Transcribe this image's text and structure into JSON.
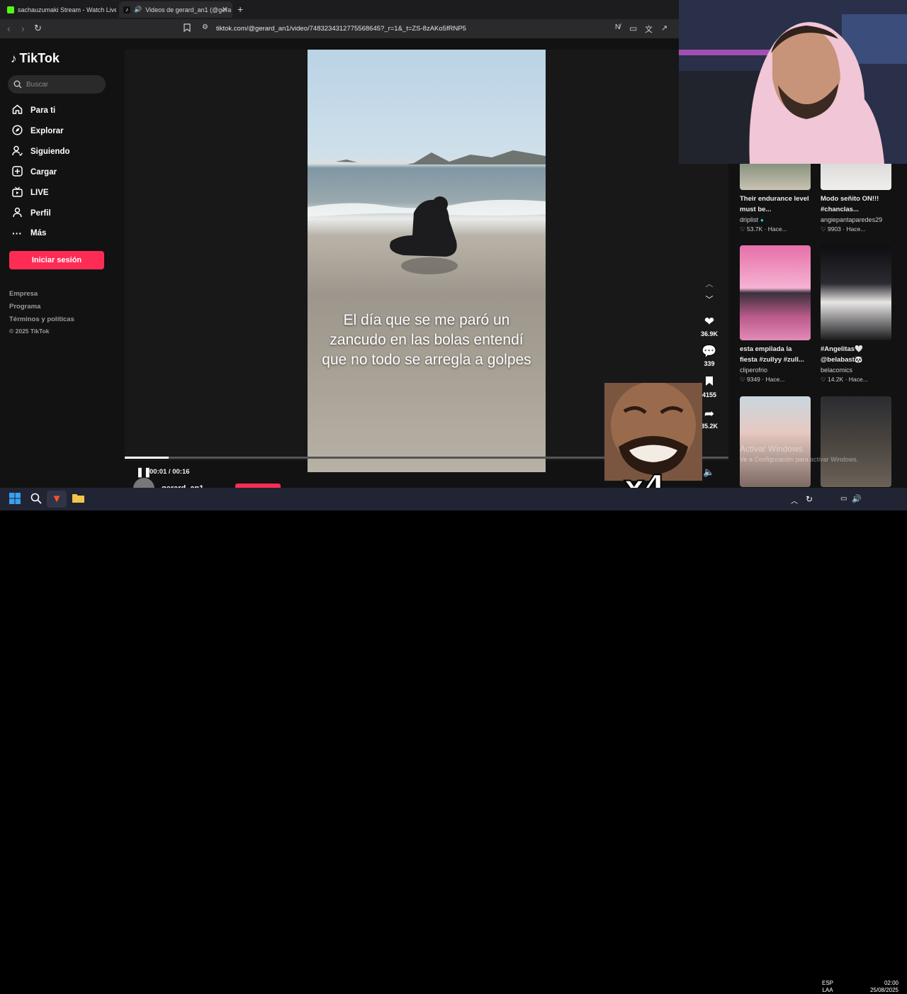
{
  "browser": {
    "tabs": [
      {
        "title": "sachauzumaki Stream - Watch Live o",
        "favicon_color": "#53fc18"
      },
      {
        "title": "Videos de gerard_an1 (@gera",
        "favicon_color": "#ffffff"
      }
    ],
    "url": "tiktok.com/@gerard_an1/video/7483234312775568645?_r=1&_t=ZS-8zAKo5fRNP5"
  },
  "sidebar": {
    "logo": "TikTok",
    "search_placeholder": "Buscar",
    "nav": [
      {
        "label": "Para ti",
        "icon": "home-icon"
      },
      {
        "label": "Explorar",
        "icon": "compass-icon"
      },
      {
        "label": "Siguiendo",
        "icon": "following-icon"
      },
      {
        "label": "Cargar",
        "icon": "upload-icon"
      },
      {
        "label": "LIVE",
        "icon": "live-tv-icon"
      },
      {
        "label": "Perfil",
        "icon": "profile-icon"
      },
      {
        "label": "Más",
        "icon": "more-icon"
      }
    ],
    "login_label": "Iniciar sesión",
    "footer_links": [
      "Empresa",
      "Programa",
      "Términos y políticas"
    ],
    "copyright": "© 2025 TikTok"
  },
  "player": {
    "caption": "El día que se me paró un zancudo en las bolas entendí que no todo se arregla a golpes",
    "time": "00:01 / 00:16",
    "progress": 0.0727,
    "likes": "36.9K",
    "comments": "339",
    "saves": "4155",
    "shares": "35.2K",
    "author": "gerard_an1"
  },
  "recommendations": [
    {
      "title": "Their endurance level must be...",
      "user": "driplist",
      "verified": true,
      "likes": "53.7K",
      "time": "Hace..."
    },
    {
      "title": "Modo señito ON!!! #chanclas...",
      "user": "angiepantaparedes29",
      "verified": false,
      "likes": "9903",
      "time": "Hace..."
    },
    {
      "title": "esta empilada la fiesta #zullyy #zull...",
      "user": "cliperofrio",
      "verified": false,
      "likes": "9349",
      "time": "Hace..."
    },
    {
      "title": "#Angelitas🤍 @belabast🐼",
      "user": "belacomics",
      "verified": false,
      "likes": "14.2K",
      "time": "Hace..."
    },
    {
      "title": "",
      "user": "",
      "verified": false,
      "likes": "",
      "time": ""
    },
    {
      "title": "",
      "user": "",
      "verified": false,
      "likes": "",
      "time": ""
    }
  ],
  "overlay": {
    "multiplier": "x4",
    "watermark_title": "Activar Windows",
    "watermark_sub": "Ve a Configuración para activar Windows."
  },
  "taskbar": {
    "lang_line1": "ESP",
    "lang_line2": "LAA",
    "time": "02:00",
    "date": "25/08/2025"
  },
  "colors": {
    "accent": "#fe2c55",
    "background": "#121212"
  }
}
